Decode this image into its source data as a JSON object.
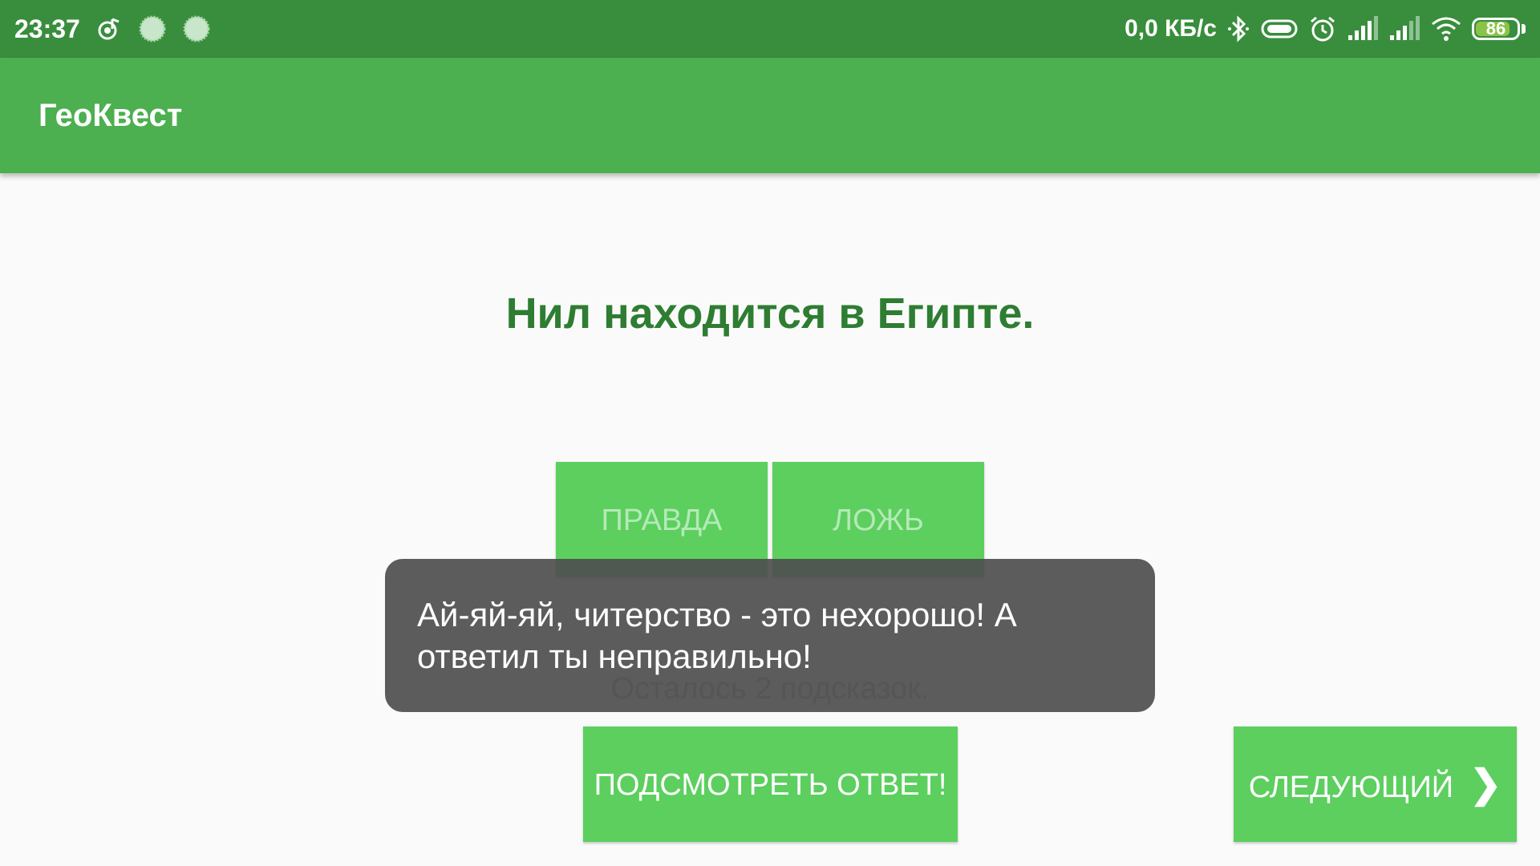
{
  "status_bar": {
    "time": "23:37",
    "network_speed": "0,0 КБ/с",
    "battery_level": "86",
    "battery_fraction": 0.86,
    "icons": [
      "music-note-icon",
      "loading-icon",
      "loading-icon",
      "bluetooth-icon",
      "toggle-icon",
      "alarm-icon",
      "signal-icon",
      "signal-icon",
      "wifi-icon",
      "battery-icon"
    ]
  },
  "app_bar": {
    "title": "ГеоКвест"
  },
  "quiz": {
    "question": "Нил находится в Египте.",
    "true_label": "ПРАВДА",
    "false_label": "ЛОЖЬ",
    "hints_remaining": "Осталось 2 подсказок.",
    "peek_label": "ПОДСМОТРЕТЬ ОТВЕТ!",
    "next_label": "СЛЕДУЮЩИЙ",
    "next_chevron": "❯"
  },
  "toast": {
    "message": "Ай-яй-яй, читерство - это нехорошо! А ответил ты неправильно!"
  },
  "colors": {
    "status_bar": "#388E3C",
    "app_bar": "#4CAF50",
    "button": "#5CCF5F",
    "question_text": "#2E7D32",
    "toast_bg": "#505050"
  }
}
